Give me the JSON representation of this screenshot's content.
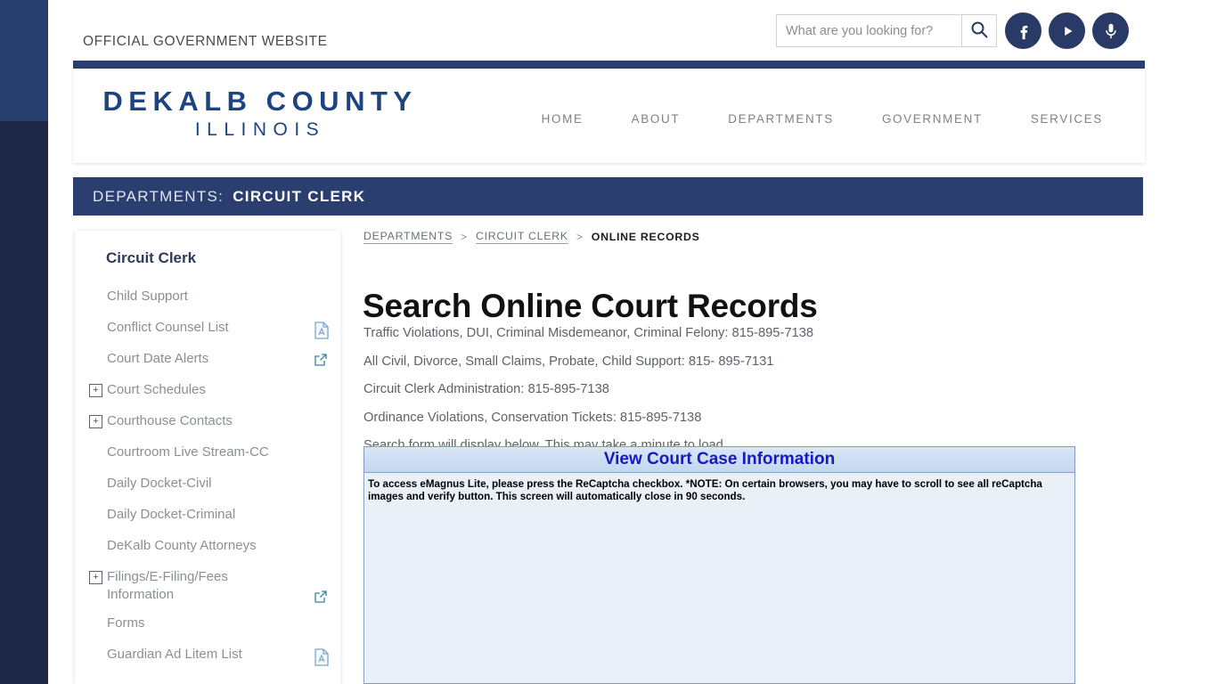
{
  "topbar": {
    "official_label": "OFFICIAL GOVERNMENT WEBSITE",
    "search_placeholder": "What are you looking for?",
    "search_value": "",
    "search_icon": "search-icon",
    "social": [
      {
        "name": "facebook-icon",
        "label": "Facebook"
      },
      {
        "name": "youtube-icon",
        "label": "YouTube"
      },
      {
        "name": "podcast-microphone-icon",
        "label": "Podcast"
      }
    ]
  },
  "brand": {
    "line1": "DEKALB COUNTY",
    "line2": "ILLINOIS",
    "color": "#1d4480"
  },
  "nav": {
    "items": [
      {
        "label": "HOME"
      },
      {
        "label": "ABOUT"
      },
      {
        "label": "DEPARTMENTS"
      },
      {
        "label": "GOVERNMENT"
      },
      {
        "label": "SERVICES"
      }
    ]
  },
  "dept_band": {
    "prefix": "DEPARTMENTS:",
    "name": "CIRCUIT CLERK",
    "bg": "#2a3f6f"
  },
  "sidebar": {
    "title": "Circuit Clerk",
    "items": [
      {
        "label": "Child Support",
        "expandable": false,
        "badge": ""
      },
      {
        "label": "Conflict Counsel List",
        "expandable": false,
        "badge": "pdf"
      },
      {
        "label": "Court Date Alerts",
        "expandable": false,
        "badge": "external"
      },
      {
        "label": "Court Schedules",
        "expandable": true,
        "badge": ""
      },
      {
        "label": "Courthouse Contacts",
        "expandable": true,
        "badge": ""
      },
      {
        "label": "Courtroom Live Stream-CC",
        "expandable": false,
        "badge": ""
      },
      {
        "label": "Daily Docket-Civil",
        "expandable": false,
        "badge": ""
      },
      {
        "label": "Daily Docket-Criminal",
        "expandable": false,
        "badge": ""
      },
      {
        "label": "DeKalb County Attorneys",
        "expandable": false,
        "badge": ""
      },
      {
        "label": "Filings/E-Filing/Fees Information",
        "expandable": true,
        "badge": "external-low"
      },
      {
        "label": "Forms",
        "expandable": false,
        "badge": ""
      },
      {
        "label": "Guardian Ad Litem List",
        "expandable": false,
        "badge": "pdf"
      }
    ]
  },
  "breadcrumb": {
    "item1": "DEPARTMENTS",
    "sep1": ">",
    "item2": "CIRCUIT CLERK",
    "sep2": ">",
    "current": "ONLINE RECORDS"
  },
  "main": {
    "title": "Search Online Court Records",
    "paragraphs": [
      "Traffic Violations, DUI, Criminal Misdemeanor, Criminal Felony: 815-895-7138",
      "All Civil, Divorce, Small Claims, Probate, Child Support: 815- 895-7131",
      "Circuit Clerk Administration: 815-895-7138",
      "Ordinance Violations, Conservation Tickets: 815-895-7138",
      "Search form will display below.  This may take a minute to load…"
    ]
  },
  "embed": {
    "header_title": "View Court Case Information",
    "note": "To access eMagnus Lite, please press the ReCaptcha checkbox. *NOTE: On certain browsers, you may have to scroll to see all reCaptcha images and verify button. This screen will automatically close in 90 seconds."
  }
}
